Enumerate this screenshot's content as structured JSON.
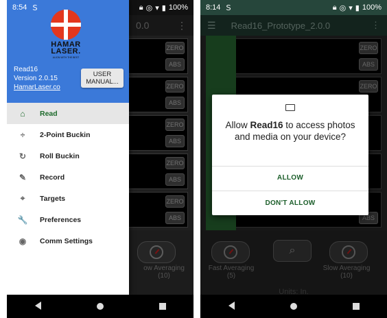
{
  "left": {
    "status": {
      "time": "8:54",
      "battery": "100%"
    },
    "appbar": {
      "title_fragment": "0.0",
      "menu": "⋮"
    },
    "channel_buttons": [
      "ZERO",
      "ABS",
      "ZERO",
      "ABS",
      "ZERO",
      "ABS",
      "ZERO",
      "ABS",
      "ZERO",
      "ABS"
    ],
    "bottom": {
      "slow_label_1": "ow Averaging",
      "slow_label_2": "(10)"
    },
    "drawer": {
      "logo": {
        "line1": "HAMAR",
        "line2": "LASER.",
        "tagline": "ALIGN WITH THE BEST"
      },
      "app_name": "Read16",
      "version": "Version 2.0.15",
      "site": "HamarLaser.co",
      "manual_button": "USER MANUAL...",
      "items": [
        {
          "label": "Read",
          "icon": "home-icon",
          "glyph": "⌂",
          "active": true
        },
        {
          "label": "2-Point Buckin",
          "icon": "two-point-icon",
          "glyph": "÷",
          "active": false
        },
        {
          "label": "Roll Buckin",
          "icon": "rotate-icon",
          "glyph": "↻",
          "active": false
        },
        {
          "label": "Record",
          "icon": "pencil-icon",
          "glyph": "✎",
          "active": false
        },
        {
          "label": "Targets",
          "icon": "target-icon",
          "glyph": "⌖",
          "active": false
        },
        {
          "label": "Preferences",
          "icon": "wrench-icon",
          "glyph": "🔧",
          "active": false
        },
        {
          "label": "Comm Settings",
          "icon": "wireless-icon",
          "glyph": "◉",
          "active": false
        }
      ]
    }
  },
  "right": {
    "status": {
      "time": "8:14",
      "battery": "100%"
    },
    "appbar": {
      "title": "Read16_Prototype_2.0.0",
      "menu": "⋮"
    },
    "channel_buttons": [
      "ZERO",
      "ABS",
      "ZERO",
      "ABS"
    ],
    "dialog": {
      "text_before": "Allow ",
      "app": "Read16",
      "text_after": " to access photos and media on your device?",
      "allow": "ALLOW",
      "deny": "DON'T ALLOW"
    },
    "bottom": {
      "fast_label_1": "Fast Averaging",
      "fast_label_2": "(5)",
      "slow_label_1": "Slow Averaging",
      "slow_label_2": "(10)",
      "units": "Units: In."
    }
  }
}
